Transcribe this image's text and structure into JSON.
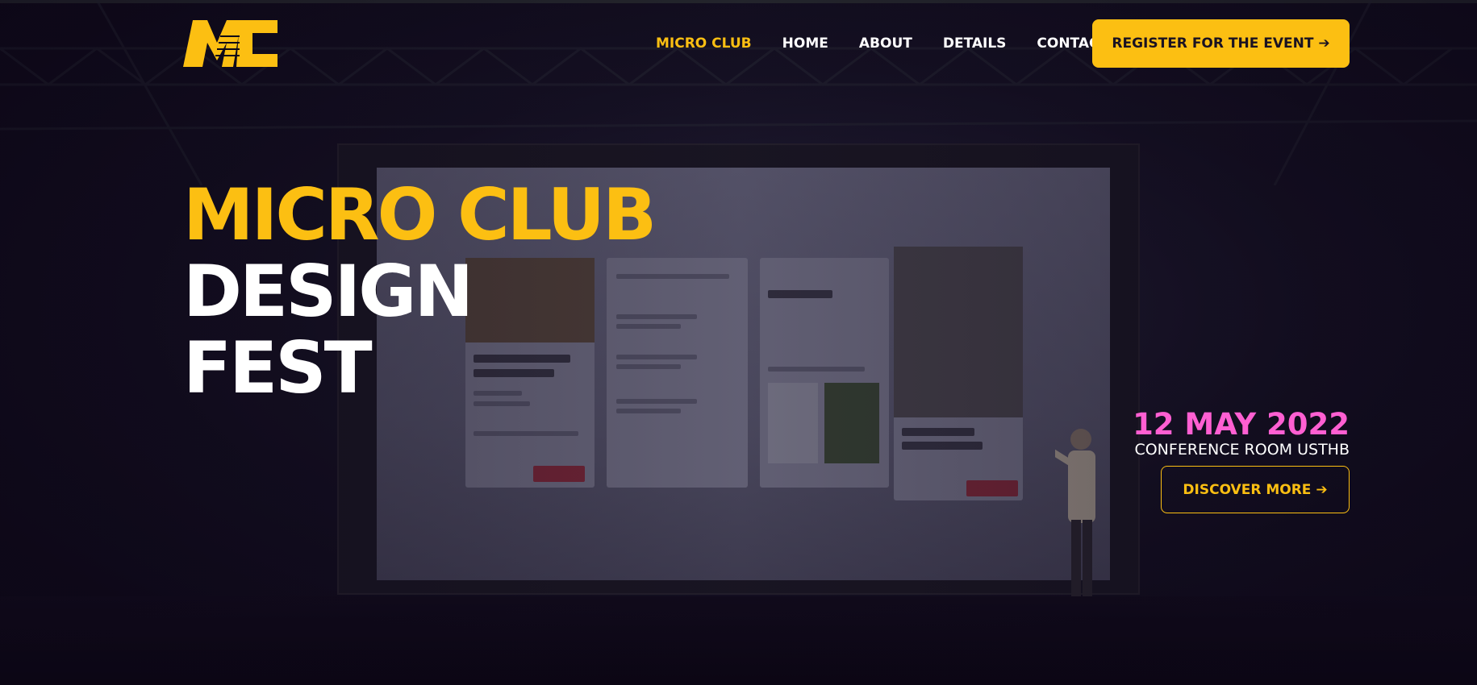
{
  "colors": {
    "accent": "#fcbf12",
    "date_pink": "#ff5fd2",
    "text": "#ffffff",
    "background": "#0d0818"
  },
  "header": {
    "logo_text": "MC",
    "nav": [
      {
        "label": "MICRO CLUB",
        "active": true
      },
      {
        "label": "HOME",
        "active": false
      },
      {
        "label": "ABOUT",
        "active": false
      },
      {
        "label": "DETAILS",
        "active": false
      },
      {
        "label": "CONTACT",
        "active": false
      }
    ],
    "register_label": "REGISTER FOR THE EVENT ➔"
  },
  "hero": {
    "title_line1": "MICRO CLUB",
    "title_line2": "DESIGN",
    "title_line3": "FEST"
  },
  "event": {
    "date": "12 MAY 2022",
    "venue": "CONFERENCE ROOM USTHB",
    "discover_label": "DISCOVER MORE ➔"
  }
}
